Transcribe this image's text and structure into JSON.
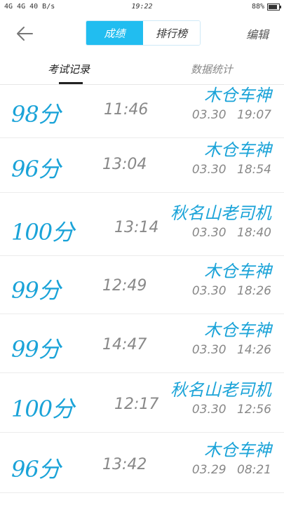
{
  "status_bar": {
    "left": "4G 4G 40 B/s",
    "time": "19:22",
    "battery": "88%",
    "battery_level": 0.88
  },
  "header": {
    "back_icon": "back-arrow-icon",
    "segments": [
      "成绩",
      "排行榜"
    ],
    "edit_label": "编辑"
  },
  "tabs": [
    "考试记录",
    "数据统计"
  ],
  "records": [
    {
      "score": "98分",
      "duration": "11:46",
      "user": "木仓车神",
      "date": "03.30",
      "time": "19:07"
    },
    {
      "score": "96分",
      "duration": "13:04",
      "user": "木仓车神",
      "date": "03.30",
      "time": "18:54"
    },
    {
      "score": "100分",
      "duration": "13:14",
      "user": "秋名山老司机",
      "date": "03.30",
      "time": "18:40"
    },
    {
      "score": "99分",
      "duration": "12:49",
      "user": "木仓车神",
      "date": "03.30",
      "time": "18:26"
    },
    {
      "score": "99分",
      "duration": "14:47",
      "user": "木仓车神",
      "date": "03.30",
      "time": "14:26"
    },
    {
      "score": "100分",
      "duration": "12:17",
      "user": "秋名山老司机",
      "date": "03.30",
      "time": "12:56"
    },
    {
      "score": "96分",
      "duration": "13:42",
      "user": "木仓车神",
      "date": "03.29",
      "time": "08:21"
    }
  ]
}
